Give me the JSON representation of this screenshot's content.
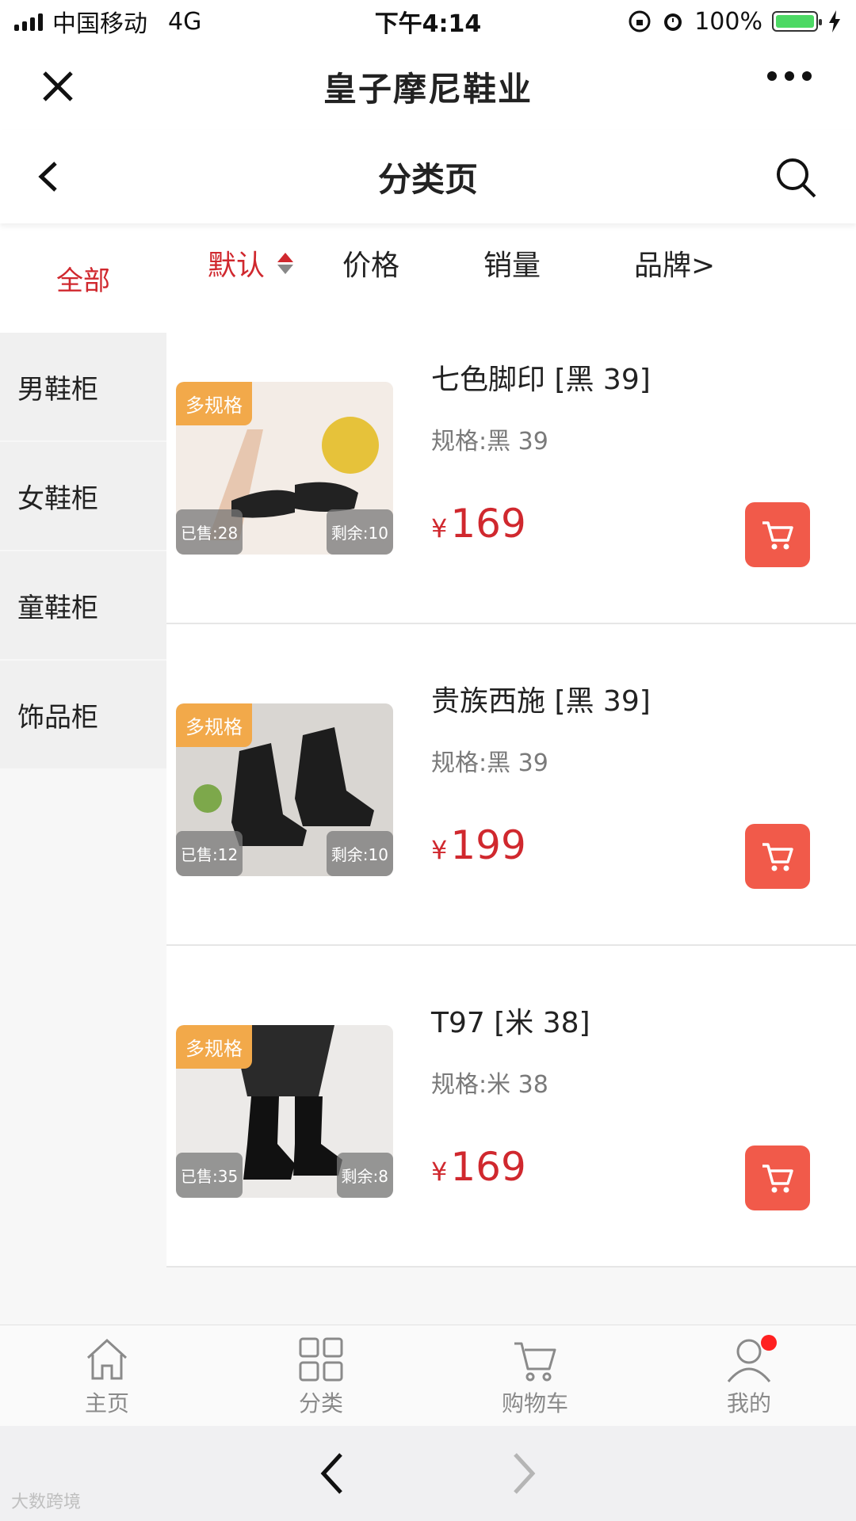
{
  "status_bar": {
    "carrier": "中国移动",
    "network": "4G",
    "time": "下午4:14",
    "battery": "100%"
  },
  "title_bar": {
    "title": "皇子摩尼鞋业"
  },
  "page_header": {
    "title": "分类页"
  },
  "sidebar": {
    "all_label": "全部",
    "items": [
      {
        "label": "男鞋柜"
      },
      {
        "label": "女鞋柜"
      },
      {
        "label": "童鞋柜"
      },
      {
        "label": "饰品柜"
      }
    ]
  },
  "sort_bar": {
    "items": [
      {
        "label": "默认"
      },
      {
        "label": "价格"
      },
      {
        "label": "销量"
      },
      {
        "label": "品牌>"
      }
    ]
  },
  "products": [
    {
      "tag": "多规格",
      "sold": "已售:28",
      "remain": "剩余:10",
      "name": "七色脚印 [黑 39]",
      "spec": "规格:黑 39",
      "currency": "¥",
      "price": "169",
      "image_icon": "shoe-icon"
    },
    {
      "tag": "多规格",
      "sold": "已售:12",
      "remain": "剩余:10",
      "name": "贵族西施 [黑 39]",
      "spec": "规格:黑 39",
      "currency": "¥",
      "price": "199",
      "image_icon": "boot-icon"
    },
    {
      "tag": "多规格",
      "sold": "已售:35",
      "remain": "剩余:8",
      "name": "T97 [米 38]",
      "spec": "规格:米 38",
      "currency": "¥",
      "price": "169",
      "image_icon": "boot-icon"
    }
  ],
  "tab_bar": {
    "items": [
      {
        "label": "主页",
        "icon": "home-icon"
      },
      {
        "label": "分类",
        "icon": "grid-icon"
      },
      {
        "label": "购物车",
        "icon": "cart-icon"
      },
      {
        "label": "我的",
        "icon": "user-icon"
      }
    ]
  },
  "watermark": "大数跨境",
  "colors": {
    "accent": "#d0282e",
    "cart_button": "#f15a4a",
    "tag": "#f2a94a"
  }
}
